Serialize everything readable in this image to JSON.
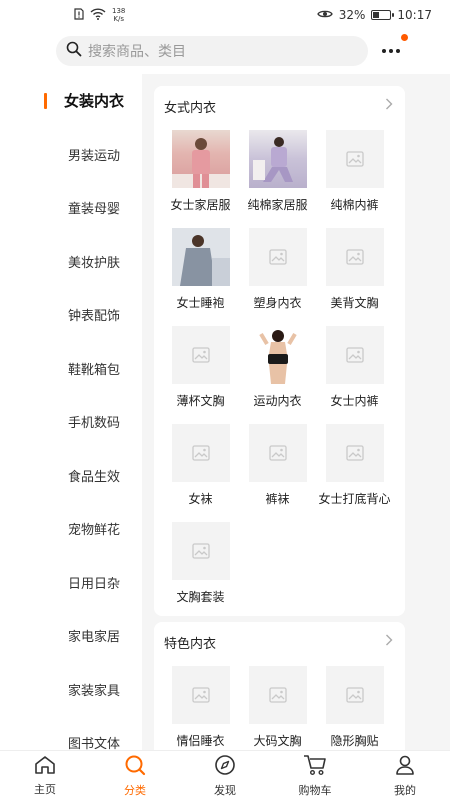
{
  "status": {
    "speed_value": "138",
    "speed_unit": "K/s",
    "battery": "32%",
    "time": "10:17"
  },
  "search": {
    "placeholder": "搜索商品、类目"
  },
  "sidebar": {
    "items": [
      {
        "label": "女装内衣"
      },
      {
        "label": "男装运动"
      },
      {
        "label": "童装母婴"
      },
      {
        "label": "美妆护肤"
      },
      {
        "label": "钟表配饰"
      },
      {
        "label": "鞋靴箱包"
      },
      {
        "label": "手机数码"
      },
      {
        "label": "食品生效"
      },
      {
        "label": "宠物鲜花"
      },
      {
        "label": "日用日杂"
      },
      {
        "label": "家电家居"
      },
      {
        "label": "家装家具"
      },
      {
        "label": "图书文体"
      }
    ]
  },
  "sections": [
    {
      "title": "女式内衣",
      "items": [
        {
          "label": "女士家居服"
        },
        {
          "label": "纯棉家居服"
        },
        {
          "label": "纯棉内裤"
        },
        {
          "label": "女士睡袍"
        },
        {
          "label": "塑身内衣"
        },
        {
          "label": "美背文胸"
        },
        {
          "label": "薄杯文胸"
        },
        {
          "label": "运动内衣"
        },
        {
          "label": "女士内裤"
        },
        {
          "label": "女袜"
        },
        {
          "label": "裤袜"
        },
        {
          "label": "女士打底背心"
        },
        {
          "label": "文胸套装"
        }
      ]
    },
    {
      "title": "特色内衣",
      "items": [
        {
          "label": "情侣睡衣"
        },
        {
          "label": "大码文胸"
        },
        {
          "label": "隐形胸贴"
        }
      ]
    }
  ],
  "tabs": [
    {
      "label": "主页"
    },
    {
      "label": "分类"
    },
    {
      "label": "发现"
    },
    {
      "label": "购物车"
    },
    {
      "label": "我的"
    }
  ],
  "colors": {
    "accent": "#ff6a00",
    "badge": "#ff5a00"
  }
}
